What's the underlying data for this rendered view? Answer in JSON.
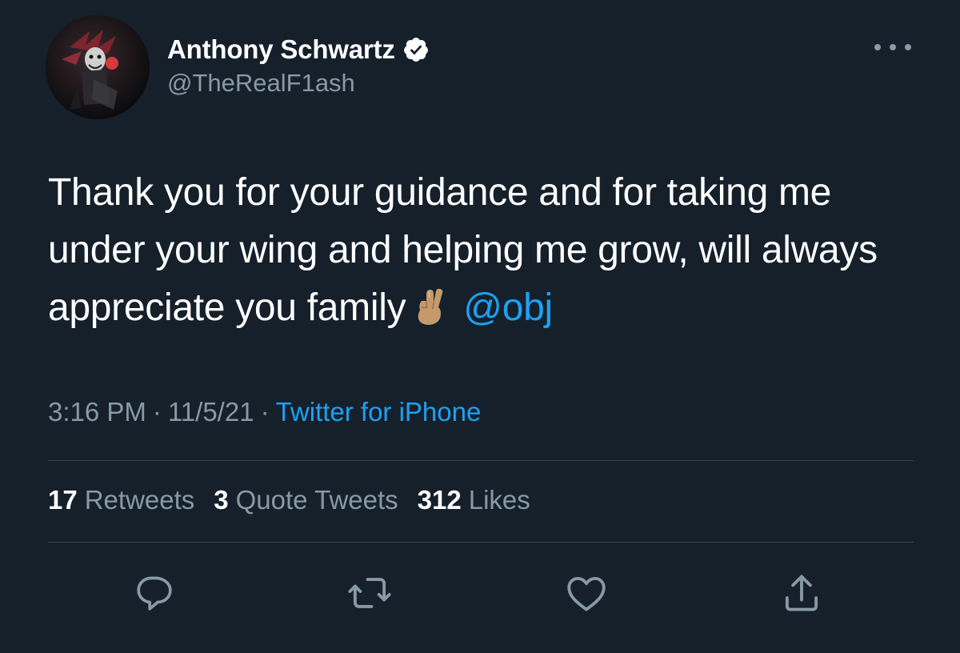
{
  "user": {
    "display_name": "Anthony Schwartz",
    "handle": "@TheRealF1ash",
    "verified": true
  },
  "tweet": {
    "text": "Thank you for your guidance and for taking me under your wing and helping me grow, will always appreciate you family",
    "emoji": "crossed-fingers-medium-skin-tone",
    "mention": "@obj",
    "time": "3:16 PM",
    "date": "11/5/21",
    "separator": "·",
    "source": "Twitter for iPhone"
  },
  "stats": [
    {
      "count": "17",
      "label": "Retweets"
    },
    {
      "count": "3",
      "label": "Quote Tweets"
    },
    {
      "count": "312",
      "label": "Likes"
    }
  ],
  "actions": [
    "reply-icon",
    "retweet-icon",
    "like-icon",
    "share-icon"
  ],
  "colors": {
    "background": "#15202b",
    "text": "#ffffff",
    "secondary": "#8899a6",
    "accent": "#1da1f2",
    "divider": "#38444d"
  }
}
